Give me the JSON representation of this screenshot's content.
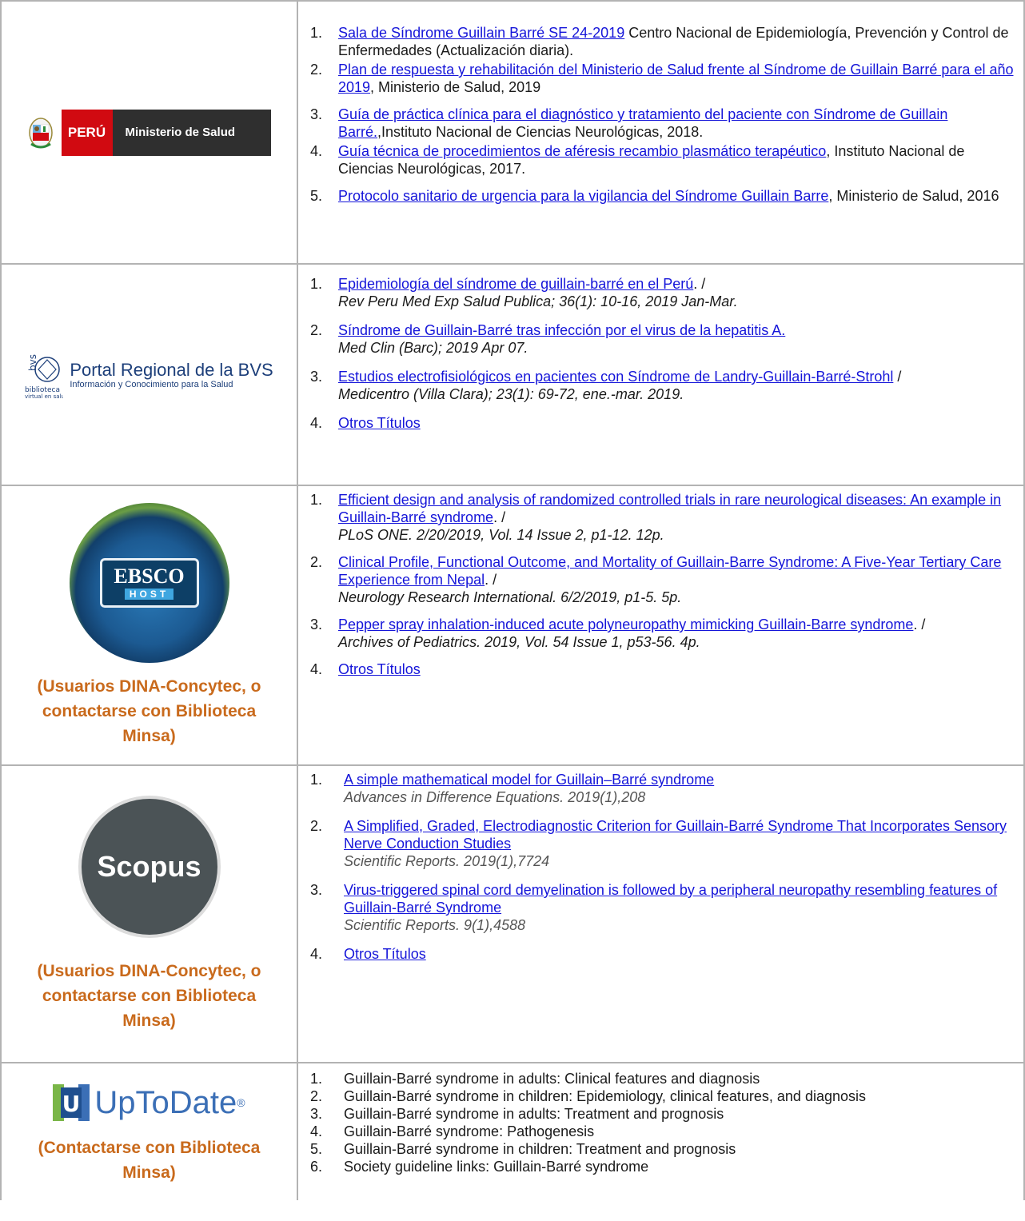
{
  "rows": [
    {
      "logo": {
        "peru": "PERÚ",
        "ministerio": "Ministerio de Salud"
      },
      "items": [
        {
          "num": "1.",
          "link": "Sala de Síndrome Guillain Barré SE 24-2019",
          "text": " Centro Nacional de Epidemiología, Prevención y Control de Enfermedades (Actualización diaria)."
        },
        {
          "num": "2.",
          "link": "Plan de respuesta y rehabilitación del Ministerio de Salud frente al Síndrome de Guillain Barré para el año 2019",
          "text": ", Ministerio de Salud, 2019"
        },
        {
          "num": "3.",
          "link": "Guía de práctica clínica para el diagnóstico y tratamiento del paciente con Síndrome de Guillain Barré.",
          "text": ",Instituto Nacional de Ciencias Neurológicas, 2018."
        },
        {
          "num": "4.",
          "link": "Guía técnica de procedimientos de aféresis recambio plasmático terapéutico",
          "text": ", Instituto Nacional de Ciencias Neurológicas, 2017."
        },
        {
          "num": "5.",
          "link": "Protocolo sanitario de urgencia para la vigilancia del Síndrome Guillain Barre",
          "text": ", Ministerio de Salud, 2016"
        }
      ]
    },
    {
      "logo": {
        "title": "Portal Regional de la BVS",
        "subtitle": "Información y Conocimiento para la Salud",
        "mark1": "biblioteca",
        "mark2": "virtual en salud",
        "mark3": "bvs"
      },
      "items": [
        {
          "num": "1.",
          "link": "Epidemiología del síndrome de guillain-barré en el Perú",
          "text": ". /",
          "cite": "Rev Peru Med Exp Salud Publica; 36(1): 10-16, 2019 Jan-Mar."
        },
        {
          "num": "2.",
          "link": "Síndrome de Guillain-Barré tras infección por el virus de la hepatitis A.",
          "text": "",
          "cite": "Med Clin (Barc); 2019 Apr 07."
        },
        {
          "num": "3.",
          "link": "Estudios electrofisiológicos en pacientes con Síndrome de Landry-Guillain-Barré-Strohl",
          "text": " /",
          "cite": "Medicentro (Villa Clara); 23(1): 69-72, ene.-mar. 2019."
        },
        {
          "num": "4.",
          "link": "Otros Títulos",
          "text": "",
          "cite": ""
        }
      ]
    },
    {
      "logo": {
        "b1": "EBSCO",
        "b2": "HOST"
      },
      "access": "(Usuarios DINA-Concytec, o contactarse con Biblioteca Minsa)",
      "items": [
        {
          "num": "1.",
          "link": "Efficient design and analysis of randomized controlled trials in rare neurological diseases: An example in Guillain-Barré syndrome",
          "text": ". /",
          "cite": "PLoS ONE. 2/20/2019, Vol. 14 Issue 2, p1-12. 12p."
        },
        {
          "num": "2.",
          "link": "Clinical Profile, Functional Outcome, and Mortality of Guillain-Barre Syndrome: A Five-Year Tertiary Care Experience from Nepal",
          "text": ". /",
          "cite": "Neurology Research International. 6/2/2019, p1-5. 5p."
        },
        {
          "num": "3.",
          "link": "Pepper spray inhalation-induced acute polyneuropathy mimicking Guillain-Barre syndrome",
          "text": ". /",
          "cite": "Archives of Pediatrics. 2019, Vol. 54 Issue 1, p53-56. 4p."
        },
        {
          "num": "4.",
          "link": "Otros Títulos",
          "text": "",
          "cite": ""
        }
      ]
    },
    {
      "logo": {
        "word": "Scopus"
      },
      "access": "(Usuarios DINA-Concytec, o contactarse con Biblioteca Minsa)",
      "items": [
        {
          "num": "1.",
          "link": "A simple mathematical model for Guillain–Barré syndrome",
          "text": "",
          "cite": "Advances in Difference Equations. 2019(1),208"
        },
        {
          "num": "2.",
          "link": "A Simplified, Graded, Electrodiagnostic Criterion for Guillain-Barré Syndrome That Incorporates Sensory Nerve Conduction Studies",
          "text": "",
          "cite": "Scientific Reports. 2019(1),7724"
        },
        {
          "num": "3.",
          "link": "Virus-triggered spinal cord demyelination is followed by a peripheral neuropathy resembling features of Guillain-Barré Syndrome",
          "text": "",
          "cite": "Scientific Reports. 9(1),4588"
        },
        {
          "num": "4.",
          "link": "Otros Títulos",
          "text": "",
          "cite": ""
        }
      ]
    },
    {
      "logo": {
        "u": "U",
        "word": "UpToDate",
        "reg": "®"
      },
      "access": "(Contactarse con Biblioteca Minsa)",
      "items": [
        {
          "num": "1.",
          "text": "Guillain-Barré syndrome in adults: Clinical features and diagnosis"
        },
        {
          "num": "2.",
          "text": "Guillain-Barré syndrome in children: Epidemiology, clinical features, and diagnosis"
        },
        {
          "num": "3.",
          "text": "Guillain-Barré syndrome in adults: Treatment and prognosis"
        },
        {
          "num": "4.",
          "text": "Guillain-Barré syndrome: Pathogenesis"
        },
        {
          "num": "5.",
          "text": "Guillain-Barré syndrome in children: Treatment and prognosis"
        },
        {
          "num": "6.",
          "text": "Society guideline links: Guillain-Barré syndrome"
        }
      ]
    }
  ],
  "colors": {
    "link": "#1515d9",
    "access": "#c96a1c",
    "border": "#b3b3b3"
  }
}
